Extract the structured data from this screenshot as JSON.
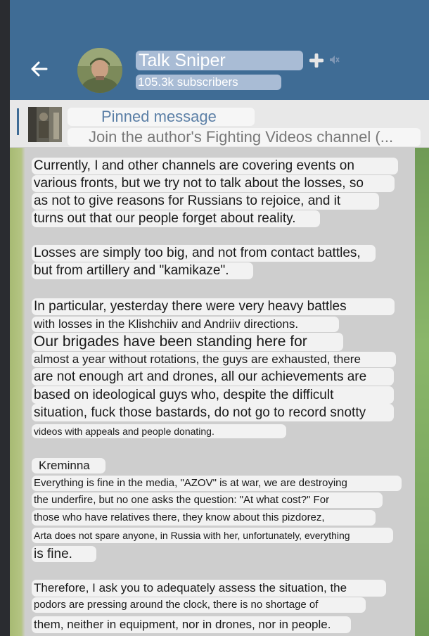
{
  "header": {
    "channel_name": "Talk Sniper",
    "subscribers": "105.3k subscribers"
  },
  "pinned": {
    "title": "Pinned message",
    "text": "Join the author's Fighting Videos channel (..."
  },
  "message": {
    "lines": [
      "Currently, I and other channels are covering events on",
      "various fronts, but we try not to talk about the losses, so",
      "as not to give reasons for Russians to rejoice, and it",
      "turns out that our people forget about reality.",
      "Losses are simply too big, and not from contact battles,",
      "but from artillery and \"kamikaze\".",
      "In particular, yesterday there were very heavy battles",
      "with losses in the Klishchiiv and Andriiv directions.",
      "Our brigades have been standing here for",
      "almost a year without rotations, the guys are exhausted, there",
      "are not enough art and drones, all our achievements are",
      "based on ideological guys who, despite the difficult",
      "situation, fuck those bastards, do not go to record snotty",
      "videos with appeals and people donating.",
      "Kreminna",
      "Everything is fine in the media, \"AZOV\" is at war, we are destroying",
      "the underfire, but no one asks the question: \"At what cost?\" For",
      "those who have relatives there, they know about this pizdorez,",
      "Arta does not spare anyone, in Russia with her, unfortunately, everything",
      "is fine.",
      "Therefore, I ask you to adequately assess the situation, the",
      "podors are pressing around the clock, there is no shortage of",
      "them, neither in equipment, nor in drones, nor in people."
    ]
  }
}
